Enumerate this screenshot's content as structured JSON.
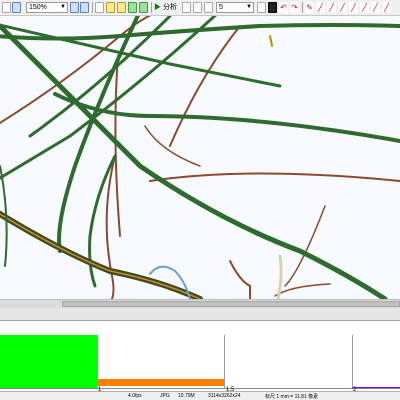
{
  "toolbar": {
    "zoom_value": "150%",
    "analyze_label": "分析",
    "count_value": "5"
  },
  "histogram": {
    "tick_labels": [
      "1",
      "1.5",
      "2"
    ]
  },
  "statusbar": {
    "items": [
      "4.0fps",
      "JPG",
      "10.79M",
      "3114x3262x24",
      "标尺 1 mm = 11.81 像素"
    ]
  },
  "colors": {
    "hist_primary": "#00ff00",
    "hist_secondary": "#ff8000",
    "hist_tail": "#8000ff",
    "fiber_green": "#2f6b2f",
    "fiber_brown": "#8b4a2b"
  }
}
